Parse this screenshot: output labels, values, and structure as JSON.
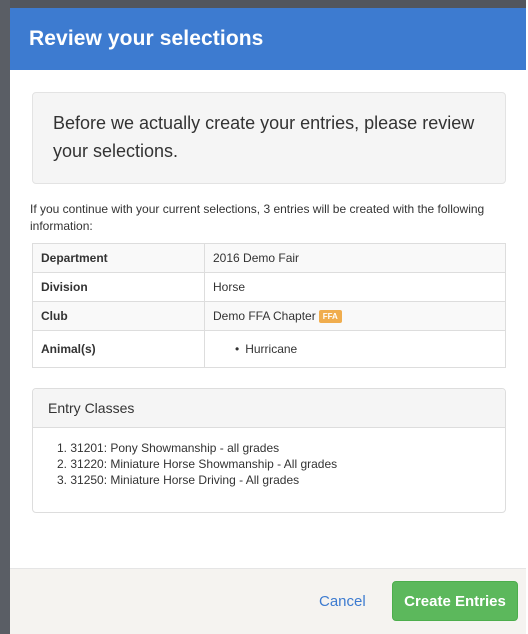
{
  "modal": {
    "title": "Review your selections",
    "notice": "Before we actually create your entries, please review your selections.",
    "intro": "If you continue with your current selections, 3 entries will be created with the following information:"
  },
  "details": {
    "department_label": "Department",
    "department_value": "2016 Demo Fair",
    "division_label": "Division",
    "division_value": "Horse",
    "club_label": "Club",
    "club_value": "Demo FFA Chapter",
    "club_badge": "FFA",
    "animals_label": "Animal(s)",
    "animals": [
      "Hurricane"
    ]
  },
  "entry_classes": {
    "heading": "Entry Classes",
    "items": [
      "1. 31201: Pony Showmanship - all grades",
      "2. 31220: Miniature Horse Showmanship - All grades",
      "3. 31250: Miniature Horse Driving - All grades"
    ]
  },
  "footer": {
    "cancel_label": "Cancel",
    "create_label": "Create Entries"
  },
  "colors": {
    "header": "#3d7bd0",
    "primary_button": "#5cb85c",
    "badge": "#f0ad4e",
    "link": "#3d7bd0"
  }
}
